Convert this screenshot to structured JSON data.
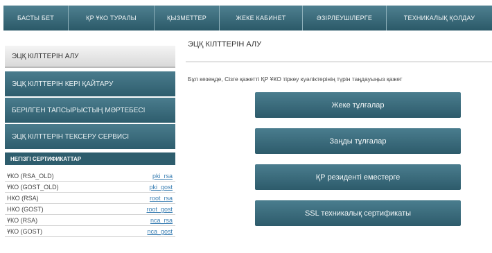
{
  "topnav": {
    "tabs": [
      "БАСТЫ БЕТ",
      "ҚР ҰКО ТУРАЛЫ",
      "ҚЫЗМЕТТЕР",
      "ЖЕКЕ КАБИНЕТ",
      "ӘЗІРЛЕУШІЛЕРГЕ",
      "ТЕХНИКАЛЫҚ ҚОЛДАУ"
    ]
  },
  "sidebar": {
    "header": "ЭЦҚ КІЛТТЕРІН АЛУ",
    "items": [
      "ЭЦҚ КІЛТТЕРІН КЕРІ ҚАЙТАРУ",
      "БЕРІЛГЕН ТАПСЫРЫСТЫҢ МӘРТЕБЕСІ",
      "ЭЦҚ КІЛТТЕРІН ТЕКСЕРУ СЕРВИСІ"
    ],
    "certs_title": "НЕГІЗГІ СЕРТИФИКАТТАР",
    "certs": [
      {
        "name": "ҰКО (RSA_OLD)",
        "link": "pki_rsa"
      },
      {
        "name": "ҰКО (GOST_OLD)",
        "link": "pki_gost"
      },
      {
        "name": "НКО (RSA)",
        "link": "root_rsa"
      },
      {
        "name": "НКО (GOST)",
        "link": "root_gost"
      },
      {
        "name": "ҰКО (RSA)",
        "link": "nca_rsa"
      },
      {
        "name": "ҰКО (GOST)",
        "link": "nca_gost"
      }
    ]
  },
  "main": {
    "title": "ЭЦҚ КІЛТТЕРІН АЛУ",
    "intro": "Бұл кезеңде, Сізге қажетті ҚР ҰКО тіркеу куәліктерінің түрін таңдауыңыз қажет",
    "buttons": [
      "Жеке тұлғалар",
      "Заңды тұлғалар",
      "ҚР резиденті еместерге",
      "SSL техникалық сертификаты"
    ]
  }
}
